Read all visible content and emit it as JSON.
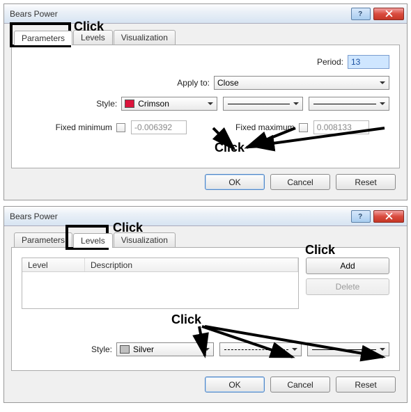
{
  "dialog1": {
    "title": "Bears Power",
    "tabs": [
      "Parameters",
      "Levels",
      "Visualization"
    ],
    "activeTab": 0,
    "periodLabel": "Period:",
    "periodValue": "13",
    "applyLabel": "Apply to:",
    "applyValue": "Close",
    "styleLabel": "Style:",
    "colorName": "Crimson",
    "colorHex": "#dc143c",
    "fixedMinLabel": "Fixed minimum",
    "fixedMinValue": "-0.006392",
    "fixedMaxLabel": "Fixed maximum",
    "fixedMaxValue": "0.008133",
    "ok": "OK",
    "cancel": "Cancel",
    "reset": "Reset"
  },
  "dialog2": {
    "title": "Bears Power",
    "tabs": [
      "Parameters",
      "Levels",
      "Visualization"
    ],
    "activeTab": 1,
    "colLevel": "Level",
    "colDesc": "Description",
    "addLabel": "Add",
    "deleteLabel": "Delete",
    "styleLabel": "Style:",
    "colorName": "Silver",
    "colorHex": "#c0c0c0",
    "ok": "OK",
    "cancel": "Cancel",
    "reset": "Reset"
  },
  "annotations": {
    "click": "Click"
  }
}
